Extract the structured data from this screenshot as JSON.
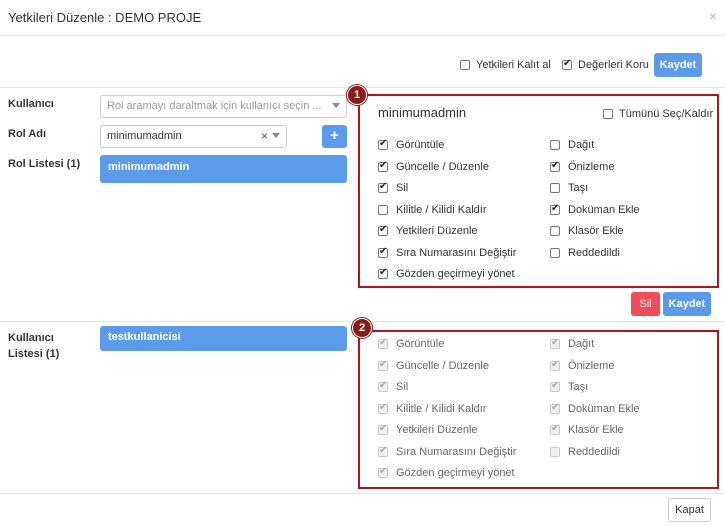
{
  "modal": {
    "title": "Yetkileri Düzenle : DEMO PROJE",
    "close": "×"
  },
  "top": {
    "inherit_label": "Yetkileri Kalıt al",
    "inherit_checked": false,
    "keep_label": "Değerleri Koru",
    "keep_checked": true,
    "save_label": "Kaydet"
  },
  "form": {
    "user_label": "Kullanıcı",
    "user_placeholder": "Rol aramayı daraltmak için kullanıcı seçin ...",
    "role_label": "Rol Adı",
    "role_value": "minimumadmin",
    "clear_glyph": "×",
    "add_glyph": "+",
    "role_list_label": "Rol Listesi (1)",
    "role_list": [
      "minimumadmin"
    ],
    "user_list_label_1": "Kullanıcı",
    "user_list_label_2": "Listesi (1)",
    "user_list": [
      "testkullanicisi"
    ]
  },
  "panel1": {
    "badge": "1",
    "role_name": "minimumadmin",
    "select_all_label": "Tümünü Seç/Kaldır",
    "select_all_checked": false,
    "left": [
      {
        "label": "Görüntüle",
        "checked": true
      },
      {
        "label": "Güncelle / Düzenle",
        "checked": true
      },
      {
        "label": "Sil",
        "checked": true
      },
      {
        "label": "Kilitle / Kilidi Kaldır",
        "checked": false
      },
      {
        "label": "Yetkileri Düzenle",
        "checked": true
      },
      {
        "label": "Sıra Numarasını Değiştir",
        "checked": true
      },
      {
        "label": "Gözden geçirmeyi yönet",
        "checked": true
      }
    ],
    "right": [
      {
        "label": "Dağıt",
        "checked": false
      },
      {
        "label": "Önizleme",
        "checked": true
      },
      {
        "label": "Taşı",
        "checked": false
      },
      {
        "label": "Doküman Ekle",
        "checked": true
      },
      {
        "label": "Klasör Ekle",
        "checked": false
      },
      {
        "label": "Reddedildi",
        "checked": false
      }
    ]
  },
  "actions": {
    "delete_label": "Sil",
    "save_label": "Kaydet"
  },
  "panel2": {
    "badge": "2",
    "left": [
      {
        "label": "Görüntüle",
        "checked": true
      },
      {
        "label": "Güncelle / Düzenle",
        "checked": true
      },
      {
        "label": "Sil",
        "checked": true
      },
      {
        "label": "Kilitle / Kilidi Kaldır",
        "checked": true
      },
      {
        "label": "Yetkileri Düzenle",
        "checked": true
      },
      {
        "label": "Sıra Numarasını Değiştir",
        "checked": true
      },
      {
        "label": "Gözden geçirmeyi yönet",
        "checked": true
      }
    ],
    "right": [
      {
        "label": "Dağıt",
        "checked": true
      },
      {
        "label": "Önizleme",
        "checked": true
      },
      {
        "label": "Taşı",
        "checked": true
      },
      {
        "label": "Doküman Ekle",
        "checked": true
      },
      {
        "label": "Klasör Ekle",
        "checked": true
      },
      {
        "label": "Reddedildi",
        "checked": false
      }
    ]
  },
  "footer": {
    "close_label": "Kapat"
  },
  "colors": {
    "accent": "#5b9bea",
    "danger": "#ee4d59",
    "highlight": "#b0131d"
  }
}
